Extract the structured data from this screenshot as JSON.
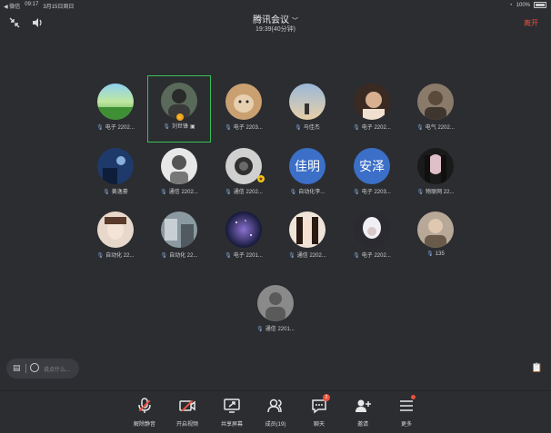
{
  "status_bar": {
    "back_app": "◀ 微信",
    "time": "09:17",
    "date": "3月15日周日",
    "battery": "100%"
  },
  "header": {
    "title": "腾讯会议",
    "subtitle": "19:39(40分钟)",
    "leave_label": "离开"
  },
  "participants": [
    {
      "label": "电子 2202...",
      "avatar": "photo-green-field"
    },
    {
      "label": "刘世锋",
      "avatar": "photo-portrait-dark",
      "active": true
    },
    {
      "label": "电子 2203...",
      "avatar": "photo-dog"
    },
    {
      "label": "马佳杰",
      "avatar": "photo-sky-person"
    },
    {
      "label": "电子 2202...",
      "avatar": "photo-portrait-warm"
    },
    {
      "label": "电气 2202...",
      "avatar": "photo-portrait-blur"
    },
    {
      "label": "黄逸豪",
      "avatar": "photo-blue-night"
    },
    {
      "label": "通信 2202...",
      "avatar": "photo-anime-boy"
    },
    {
      "label": "通信 2202...",
      "avatar": "photo-car-interior"
    },
    {
      "label": "自动化李...",
      "avatar_text": "佳明"
    },
    {
      "label": "电子 2203...",
      "avatar_text": "安泽"
    },
    {
      "label": "物联网 22...",
      "avatar": "photo-anime-girl-dark"
    },
    {
      "label": "自动化 22...",
      "avatar": "photo-anime-girl-light"
    },
    {
      "label": "自动化 22...",
      "avatar": "photo-room"
    },
    {
      "label": "电子 2201...",
      "avatar": "photo-galaxy"
    },
    {
      "label": "通信 2202...",
      "avatar": "photo-woman-portrait"
    },
    {
      "label": "电子 2202...",
      "avatar": "photo-anime-white-hair"
    },
    {
      "label": "135",
      "avatar": "photo-man-portrait"
    },
    {
      "label": "通信 2201...",
      "avatar": "photo-default-gray"
    }
  ],
  "chat": {
    "placeholder": "说点什么..."
  },
  "toolbar": [
    {
      "label": "解除静音",
      "icon": "mic-muted-icon"
    },
    {
      "label": "开启视频",
      "icon": "video-off-icon"
    },
    {
      "label": "共享屏幕",
      "icon": "share-screen-icon"
    },
    {
      "label": "成员(19)",
      "icon": "members-icon"
    },
    {
      "label": "聊天",
      "icon": "chat-icon",
      "badge": "2"
    },
    {
      "label": "邀请",
      "icon": "invite-icon"
    },
    {
      "label": "更多",
      "icon": "more-icon"
    }
  ],
  "colors": {
    "accent": "#e8513d",
    "active_border": "#3bbf5a",
    "text_avatar": "#3b6fc8",
    "background": "#2b2d31"
  }
}
